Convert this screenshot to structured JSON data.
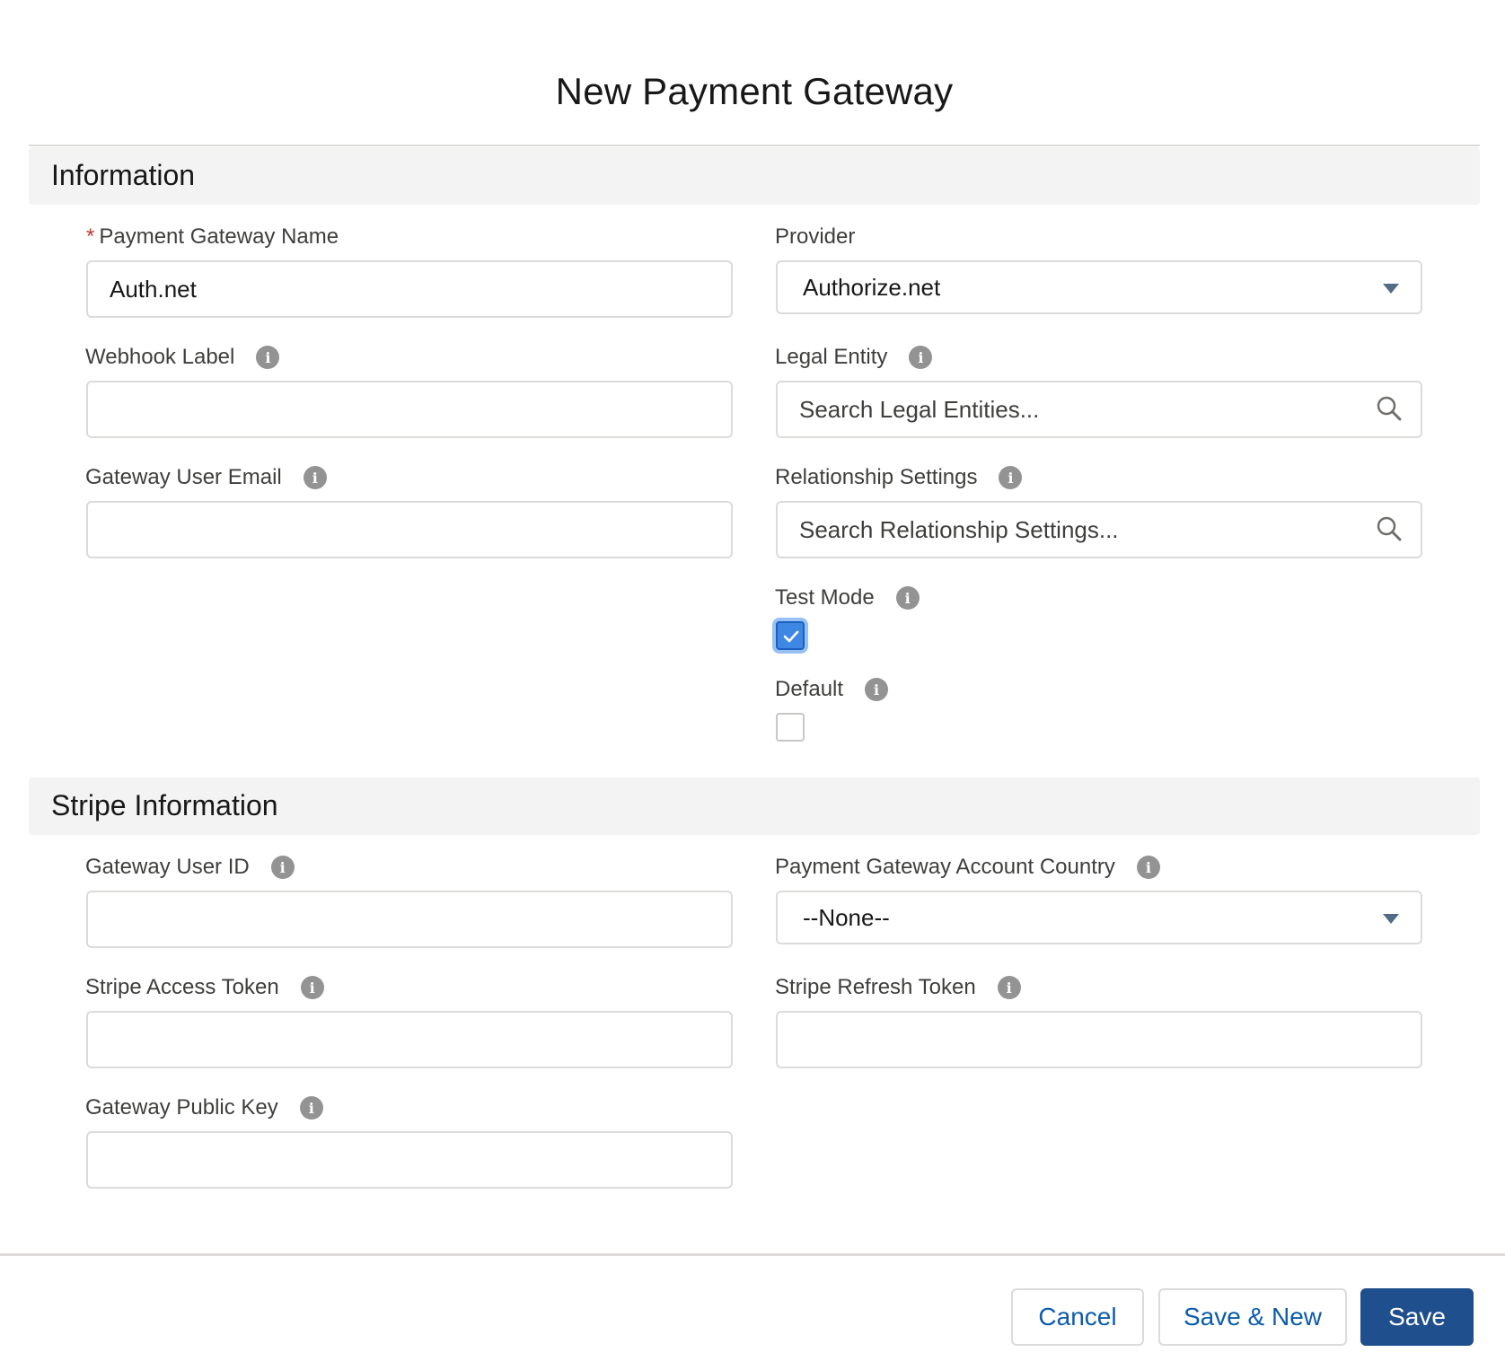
{
  "modal": {
    "title": "New Payment Gateway"
  },
  "sections": {
    "information": "Information",
    "stripe": "Stripe Information"
  },
  "fields": {
    "payment_gateway_name": {
      "label": "Payment Gateway Name",
      "required_marker": "*",
      "value": "Auth.net"
    },
    "provider": {
      "label": "Provider",
      "value": "Authorize.net"
    },
    "webhook_label": {
      "label": "Webhook Label",
      "value": ""
    },
    "legal_entity": {
      "label": "Legal Entity",
      "placeholder": "Search Legal Entities..."
    },
    "gateway_user_email": {
      "label": "Gateway User Email",
      "value": ""
    },
    "relationship_settings": {
      "label": "Relationship Settings",
      "placeholder": "Search Relationship Settings..."
    },
    "test_mode": {
      "label": "Test Mode",
      "checked": true
    },
    "default": {
      "label": "Default",
      "checked": false
    },
    "gateway_user_id": {
      "label": "Gateway User ID",
      "value": ""
    },
    "account_country": {
      "label": "Payment Gateway Account Country",
      "value": "--None--"
    },
    "stripe_access_token": {
      "label": "Stripe Access Token",
      "value": ""
    },
    "stripe_refresh_token": {
      "label": "Stripe Refresh Token",
      "value": ""
    },
    "gateway_public_key": {
      "label": "Gateway Public Key",
      "value": ""
    }
  },
  "info_icon_glyph": "i",
  "footer": {
    "cancel": "Cancel",
    "save_new": "Save & New",
    "save": "Save"
  },
  "colors": {
    "brand": "#1f4f8d",
    "link": "#0b5cab",
    "required": "#c23934",
    "checkbox_checked": "#3f87e5"
  }
}
